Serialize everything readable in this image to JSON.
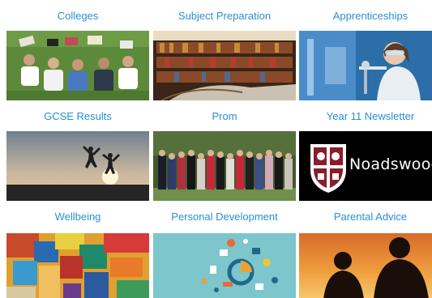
{
  "tiles": [
    {
      "label": "Colleges"
    },
    {
      "label": "Subject Preparation"
    },
    {
      "label": "Apprenticeships"
    },
    {
      "label": "GCSE Results"
    },
    {
      "label": "Prom"
    },
    {
      "label": "Year 11 Newsletter"
    },
    {
      "label": "Wellbeing"
    },
    {
      "label": "Personal Development"
    },
    {
      "label": "Parental Advice"
    }
  ],
  "newsletter_brand": "Noadswood",
  "colors": {
    "title": "#2a8fd0",
    "background": "#ffffff"
  }
}
